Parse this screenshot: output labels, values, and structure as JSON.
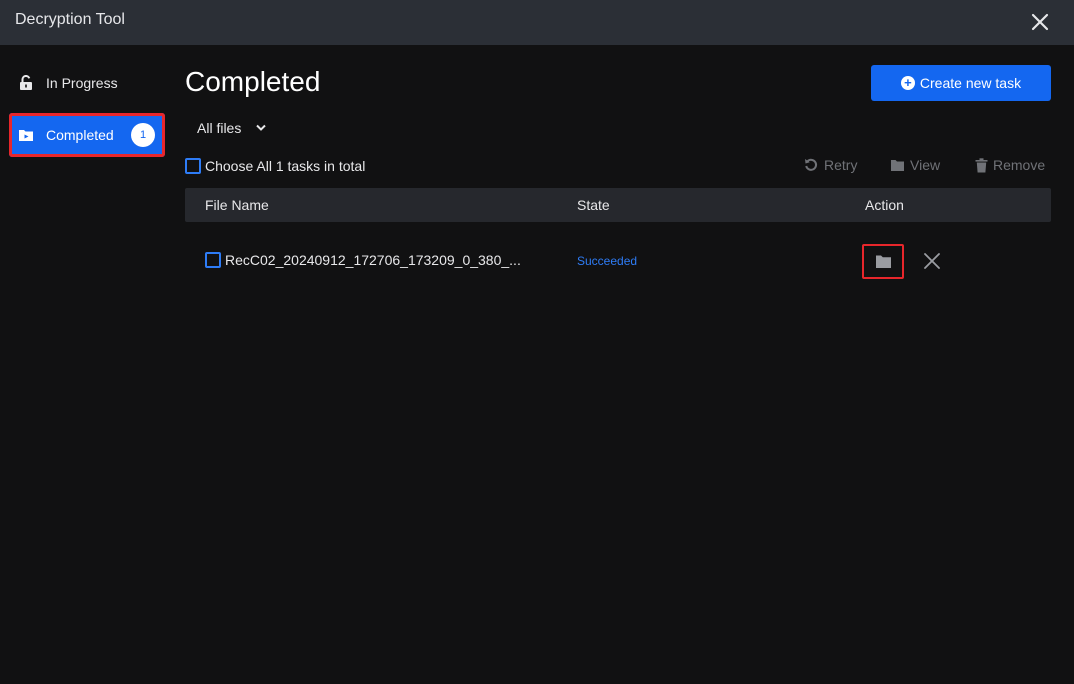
{
  "window": {
    "title": "Decryption Tool"
  },
  "sidebar": {
    "items": [
      {
        "label": "In Progress",
        "icon": "unlock-icon"
      },
      {
        "label": "Completed",
        "icon": "video-folder-icon",
        "count": "1"
      }
    ]
  },
  "main": {
    "title": "Completed",
    "create_button": "Create new task",
    "filter": {
      "selected": "All files"
    },
    "choose_all": "Choose All 1 tasks in total",
    "toolbar": {
      "retry": "Retry",
      "view": "View",
      "remove": "Remove"
    },
    "table": {
      "columns": [
        "File Name",
        "State",
        "Action"
      ],
      "rows": [
        {
          "file_name": "RecC02_20240912_172706_173209_0_380_...",
          "state": "Succeeded"
        }
      ]
    }
  },
  "colors": {
    "accent": "#1467f0",
    "highlight": "#e8262b",
    "state_success": "#2e7cf6",
    "titlebar": "#2b2f36",
    "background": "#111112"
  }
}
